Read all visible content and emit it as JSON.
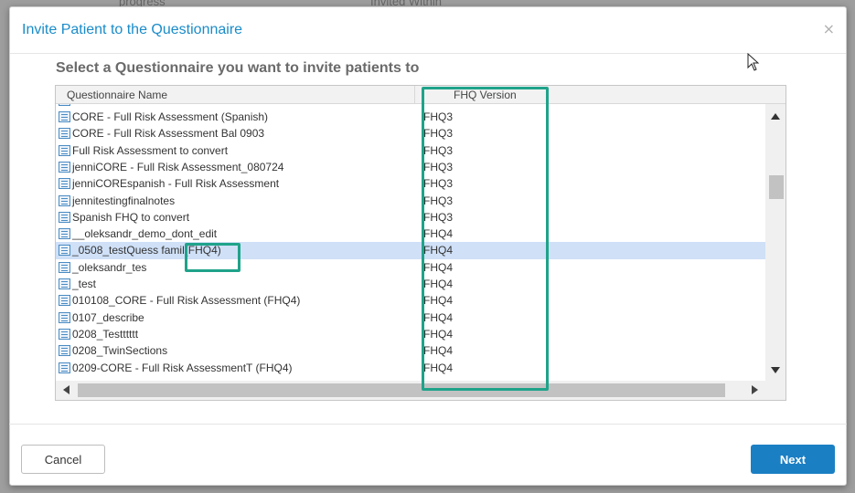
{
  "background": {
    "top_left_text": "progress",
    "top_mid_text": "Invited Within"
  },
  "dialog": {
    "title": "Invite Patient to the Questionnaire",
    "close_glyph": "×",
    "prompt": "Select a Questionnaire you want to invite patients to"
  },
  "grid": {
    "columns": [
      "Questionnaire Name",
      "FHQ Version"
    ],
    "rows": [
      {
        "name": "CORE - Full Risk Assessment (Spanish)",
        "version": "FHQ3"
      },
      {
        "name": "CORE - Full Risk Assessment Bal 0903",
        "version": "FHQ3"
      },
      {
        "name": "Full Risk Assessment to convert",
        "version": "FHQ3"
      },
      {
        "name": "jenniCORE - Full Risk Assessment_080724",
        "version": "FHQ3"
      },
      {
        "name": "jenniCOREspanish - Full Risk Assessment",
        "version": "FHQ3"
      },
      {
        "name": "jennitestingfinalnotes",
        "version": "FHQ3"
      },
      {
        "name": "Spanish FHQ to convert",
        "version": "FHQ3"
      },
      {
        "name": "__oleksandr_demo_dont_edit",
        "version": "FHQ4"
      },
      {
        "name": "_0508_testQuess famil(FHQ4)",
        "version": "FHQ4"
      },
      {
        "name": "_oleksandr_tes",
        "version": "FHQ4"
      },
      {
        "name": "_test",
        "version": "FHQ4"
      },
      {
        "name": "010108_CORE - Full Risk Assessment (FHQ4)",
        "version": "FHQ4"
      },
      {
        "name": "0107_describe",
        "version": "FHQ4"
      },
      {
        "name": "0208_Testttttt",
        "version": "FHQ4"
      },
      {
        "name": "0208_TwinSections",
        "version": "FHQ4"
      },
      {
        "name": "0209-CORE - Full Risk AssessmentT (FHQ4)",
        "version": "FHQ4"
      }
    ],
    "selected_index": 8
  },
  "footer": {
    "cancel_label": "Cancel",
    "next_label": "Next"
  },
  "colors": {
    "title": "#1a8cc9",
    "highlight_box": "#1fa38a",
    "selected_row": "#cfe0f7",
    "primary_button": "#1b7fc4"
  },
  "icons": {
    "row_icon": "list-document-icon",
    "close": "close-icon",
    "cursor": "mouse-pointer-icon"
  }
}
